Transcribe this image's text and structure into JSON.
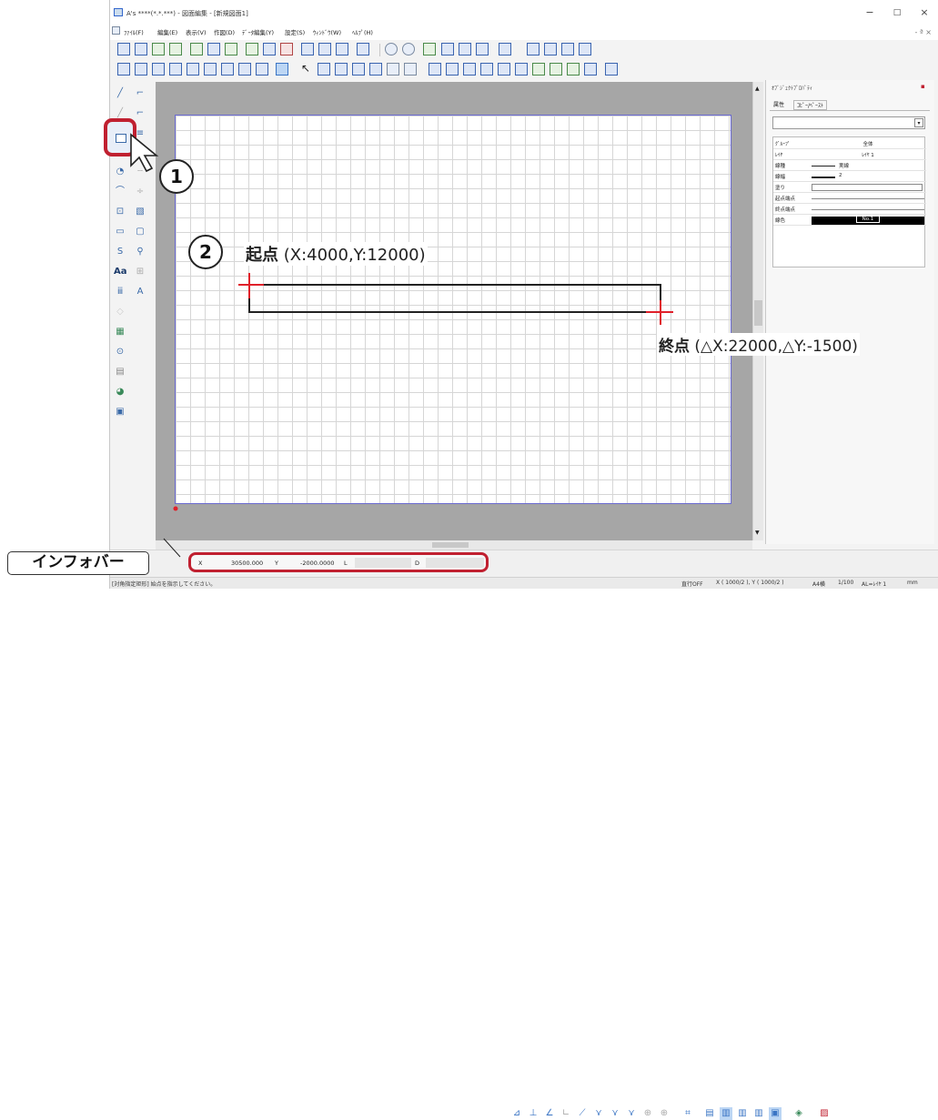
{
  "window": {
    "title": "A's ****(*.*.***) - 図面編集 - [新規図面1]",
    "minimize": "−",
    "maximize": "□",
    "close": "×"
  },
  "menu": [
    "ﾌｧｲﾙ(F)",
    "編集(E)",
    "表示(V)",
    "作図(D)",
    "ﾃﾞｰﾀ編集(Y)",
    "設定(S)",
    "ｳｨﾝﾄﾞｳ(W)",
    "ﾍﾙﾌﾟ(H)"
  ],
  "mdi_controls": "- ª ×",
  "panel": {
    "title": "ｵﾌﾞｼﾞｪｸﾄﾌﾟﾛﾊﾟﾃｨ",
    "pin": "▪",
    "tabs": [
      "属性",
      "ｺﾋﾟｰ/ﾍﾟｰｽﾄ"
    ],
    "combo_value": "",
    "properties": [
      {
        "key": "ｸﾞﾙｰﾌﾟ",
        "value": "全体"
      },
      {
        "key": "ﾚｲﾔ",
        "value": "ﾚｲﾔ 1"
      },
      {
        "key": "線種",
        "value": "実線"
      },
      {
        "key": "線幅",
        "value": "2"
      },
      {
        "key": "塗り",
        "value": ""
      },
      {
        "key": "起点端点",
        "value": ""
      },
      {
        "key": "終点端点",
        "value": ""
      },
      {
        "key": "線色",
        "value": "No.1"
      }
    ]
  },
  "infobar": {
    "label": "インフォバー",
    "x_label": "X",
    "x_value": "30500.000",
    "y_label": "Y",
    "y_value": "-2000.0000",
    "l_label": "L",
    "d_label": "D"
  },
  "statusbar": {
    "prompt": "[対角指定矩形] 始点を指示してください。",
    "snap": "直行OFF",
    "x_scale": "X ( 1000/2 ), Y ( 1000/2 )",
    "paper": "A4横",
    "scale": "1/100",
    "layer": "AL=ﾚｲﾔ 1",
    "unit": "mm"
  },
  "annotations": {
    "callout1": "1",
    "callout2": "2",
    "start_label": "起点",
    "start_coords": "(X:4000,Y:12000)",
    "end_label": "終点",
    "end_coords": "(△X:22000,△Y:-1500)"
  },
  "colors": {
    "accent_red": "#c02030",
    "crosshair": "#e0202a",
    "sheet_border": "#6a6ad0"
  },
  "icons": [
    "line-icon",
    "rectangle-icon",
    "circle-icon",
    "arc-icon",
    "text-icon",
    "zoom-icon",
    "undo-icon",
    "redo-icon",
    "print-icon",
    "save-icon"
  ]
}
